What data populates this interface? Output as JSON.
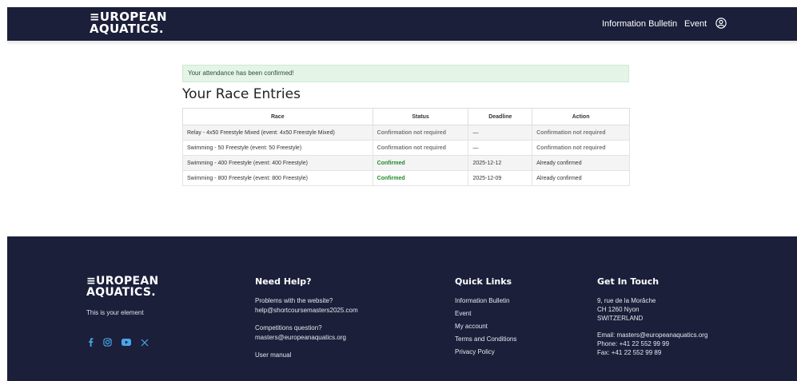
{
  "header": {
    "logo_line1": "≡UROPEAN",
    "logo_line2": "AQUATICS.",
    "nav": [
      "Information Bulletin",
      "Event"
    ],
    "user_icon": "user-circle-icon"
  },
  "alert": "Your attendance has been confirmed!",
  "title": "Your Race Entries",
  "table": {
    "headers": [
      "Race",
      "Status",
      "Deadline",
      "Action"
    ],
    "rows": [
      {
        "race": "Relay - 4x50 Freestyle Mixed (event: 4x50 Freestyle Mixed)",
        "status": "Confirmation not required",
        "deadline": "—",
        "action": "Confirmation not required"
      },
      {
        "race": "Swimming - 50 Freestyle (event: 50 Freestyle)",
        "status": "Confirmation not required",
        "deadline": "—",
        "action": "Confirmation not required"
      },
      {
        "race": "Swimming - 400 Freestyle (event: 400 Freestyle)",
        "status": "Confirmed",
        "deadline": "2025-12-12",
        "action": "Already confirmed"
      },
      {
        "race": "Swimming - 800 Freestyle (event: 800 Freestyle)",
        "status": "Confirmed",
        "deadline": "2025-12-09",
        "action": "Already confirmed"
      }
    ]
  },
  "footer": {
    "logo_line1": "≡UROPEAN",
    "logo_line2": "AQUATICS.",
    "tagline": "This is your element",
    "socials": [
      "facebook-icon",
      "instagram-icon",
      "youtube-icon",
      "x-icon"
    ],
    "help": {
      "title": "Need Help?",
      "lines": [
        "Problems with the website?",
        "help@shortcoursemasters2025.com",
        "Competitions question?",
        "masters@europeanaquatics.org",
        "User manual"
      ]
    },
    "links": {
      "title": "Quick Links",
      "items": [
        "Information Bulletin",
        "Event",
        "My account",
        "Terms and Conditions",
        "Privacy Policy"
      ]
    },
    "touch": {
      "title": "Get In Touch",
      "address": [
        "9, rue de la Morâche",
        "CH 1260 Nyon",
        "SWITZERLAND"
      ],
      "contact": [
        "Email: masters@europeanaquatics.org",
        "Phone: +41 22 552 99 99",
        "Fax: +41 22 552 99 89"
      ]
    }
  },
  "colors": {
    "navy": "#1b1f3a",
    "logo_accent": "#4aa6e8",
    "success_bg": "#e4f4e6",
    "confirmed": "#1f8a2c"
  }
}
